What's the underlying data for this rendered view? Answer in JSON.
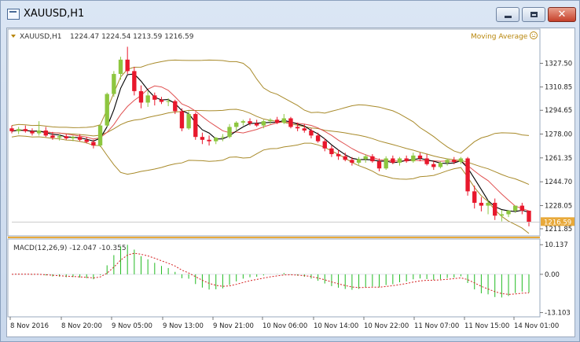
{
  "window": {
    "title": "XAUUSD,H1",
    "buttons": [
      "minimize",
      "maximize",
      "close"
    ],
    "close_glyph": "✕"
  },
  "chart_header": {
    "symbol": "XAUUSD,H1",
    "ohlc": "1224.47 1224.54 1213.59 1216.59",
    "indicator_label": "Moving Average",
    "indicator_icon": "smiley-icon"
  },
  "macd_header": {
    "label": "MACD(12,26,9) -12.047 -10.355"
  },
  "colors": {
    "bull": "#8dc63f",
    "bear": "#e8182c",
    "bands": "#a88a2a",
    "ma_fast": "#000000",
    "ma_slow": "#e05050",
    "macd_hist": "#22bb22",
    "macd_signal": "#d42020",
    "grid_text": "#222222",
    "price_tag": "#e8a93a"
  },
  "chart_data": [
    {
      "type": "candlestick",
      "title": "XAUUSD,H1",
      "y_ticks": [
        "1327.50",
        "1310.85",
        "1294.65",
        "1278.00",
        "1261.35",
        "1244.70",
        "1228.05",
        "1211.85"
      ],
      "ylim": [
        1208,
        1342
      ],
      "current_price": "1216.59",
      "x_ticks": [
        "8 Nov 2016",
        "8 Nov 20:00",
        "9 Nov 05:00",
        "9 Nov 13:00",
        "9 Nov 21:00",
        "10 Nov 06:00",
        "10 Nov 14:00",
        "10 Nov 22:00",
        "11 Nov 07:00",
        "11 Nov 15:00",
        "14 Nov 01:00"
      ],
      "candles": [
        [
          1282.0,
          1284.0,
          1278.5,
          1280.0
        ],
        [
          1280.0,
          1283.0,
          1278.0,
          1281.5
        ],
        [
          1281.5,
          1284.0,
          1279.0,
          1280.0
        ],
        [
          1280.0,
          1282.0,
          1277.0,
          1278.5
        ],
        [
          1278.5,
          1287.0,
          1277.0,
          1280.5
        ],
        [
          1280.5,
          1283.0,
          1276.0,
          1277.0
        ],
        [
          1277.0,
          1279.5,
          1274.0,
          1275.5
        ],
        [
          1275.5,
          1278.0,
          1273.5,
          1276.5
        ],
        [
          1276.5,
          1278.0,
          1274.0,
          1275.0
        ],
        [
          1275.0,
          1277.0,
          1273.0,
          1276.0
        ],
        [
          1276.0,
          1278.0,
          1273.0,
          1274.0
        ],
        [
          1274.0,
          1276.0,
          1271.5,
          1272.5
        ],
        [
          1272.5,
          1274.0,
          1268.0,
          1270.0
        ],
        [
          1270.0,
          1284.5,
          1269.0,
          1284.0
        ],
        [
          1284.0,
          1307.0,
          1283.0,
          1306.0
        ],
        [
          1306.0,
          1322.0,
          1304.0,
          1320.0
        ],
        [
          1320.0,
          1332.0,
          1316.0,
          1330.0
        ],
        [
          1330.0,
          1339.0,
          1320.0,
          1322.0
        ],
        [
          1322.0,
          1325.0,
          1305.0,
          1308.0
        ],
        [
          1308.0,
          1312.0,
          1296.0,
          1300.0
        ],
        [
          1300.0,
          1308.0,
          1297.0,
          1305.0
        ],
        [
          1305.0,
          1307.0,
          1298.0,
          1302.0
        ],
        [
          1302.0,
          1304.0,
          1299.0,
          1300.5
        ],
        [
          1300.5,
          1303.0,
          1297.5,
          1301.0
        ],
        [
          1301.0,
          1302.0,
          1292.0,
          1294.0
        ],
        [
          1294.0,
          1296.0,
          1280.0,
          1282.0
        ],
        [
          1282.0,
          1294.0,
          1281.0,
          1292.0
        ],
        [
          1292.0,
          1293.0,
          1274.0,
          1276.0
        ],
        [
          1276.0,
          1279.0,
          1271.0,
          1274.0
        ],
        [
          1274.0,
          1277.0,
          1270.0,
          1273.0
        ],
        [
          1273.0,
          1276.0,
          1271.0,
          1275.5
        ],
        [
          1275.5,
          1278.0,
          1273.0,
          1276.0
        ],
        [
          1276.0,
          1285.0,
          1275.0,
          1283.0
        ],
        [
          1283.0,
          1287.0,
          1280.0,
          1286.0
        ],
        [
          1286.0,
          1288.0,
          1284.0,
          1287.0
        ],
        [
          1287.0,
          1289.0,
          1284.0,
          1285.5
        ],
        [
          1285.5,
          1288.0,
          1283.0,
          1284.0
        ],
        [
          1284.0,
          1288.0,
          1282.0,
          1287.0
        ],
        [
          1287.0,
          1289.0,
          1285.0,
          1288.0
        ],
        [
          1288.0,
          1290.0,
          1285.0,
          1286.0
        ],
        [
          1286.0,
          1292.0,
          1285.0,
          1289.0
        ],
        [
          1289.0,
          1290.0,
          1282.0,
          1283.0
        ],
        [
          1283.0,
          1286.0,
          1280.0,
          1282.0
        ],
        [
          1282.0,
          1285.0,
          1279.0,
          1280.5
        ],
        [
          1280.5,
          1282.0,
          1275.0,
          1277.0
        ],
        [
          1277.0,
          1279.0,
          1272.0,
          1273.0
        ],
        [
          1273.0,
          1275.0,
          1266.0,
          1268.0
        ],
        [
          1268.0,
          1270.0,
          1262.0,
          1264.0
        ],
        [
          1264.0,
          1267.0,
          1260.0,
          1262.5
        ],
        [
          1262.5,
          1265.0,
          1259.0,
          1260.0
        ],
        [
          1260.0,
          1262.0,
          1256.0,
          1258.0
        ],
        [
          1258.0,
          1262.0,
          1256.5,
          1260.5
        ],
        [
          1260.5,
          1264.0,
          1258.0,
          1262.5
        ],
        [
          1262.5,
          1264.0,
          1258.0,
          1259.0
        ],
        [
          1259.0,
          1261.0,
          1252.0,
          1254.0
        ],
        [
          1254.0,
          1262.5,
          1253.0,
          1261.0
        ],
        [
          1261.0,
          1263.0,
          1257.0,
          1258.0
        ],
        [
          1258.0,
          1262.0,
          1256.0,
          1261.0
        ],
        [
          1261.0,
          1263.0,
          1258.0,
          1259.0
        ],
        [
          1259.0,
          1265.0,
          1258.0,
          1263.0
        ],
        [
          1263.0,
          1265.0,
          1259.0,
          1261.0
        ],
        [
          1261.0,
          1264.0,
          1256.0,
          1257.0
        ],
        [
          1257.0,
          1259.0,
          1253.0,
          1255.0
        ],
        [
          1255.0,
          1259.0,
          1254.0,
          1258.0
        ],
        [
          1258.0,
          1261.0,
          1256.0,
          1260.0
        ],
        [
          1260.0,
          1262.0,
          1257.0,
          1258.5
        ],
        [
          1258.5,
          1262.0,
          1257.0,
          1261.0
        ],
        [
          1261.0,
          1262.0,
          1235.0,
          1238.0
        ],
        [
          1238.0,
          1242.0,
          1226.0,
          1230.0
        ],
        [
          1230.0,
          1234.0,
          1224.0,
          1228.0
        ],
        [
          1228.0,
          1232.0,
          1222.0,
          1230.0
        ],
        [
          1230.0,
          1233.0,
          1218.0,
          1221.0
        ],
        [
          1221.0,
          1225.0,
          1217.0,
          1222.0
        ],
        [
          1222.0,
          1225.0,
          1220.0,
          1224.5
        ],
        [
          1224.5,
          1228.0,
          1223.0,
          1228.0
        ],
        [
          1228.0,
          1230.0,
          1222.0,
          1224.5
        ],
        [
          1224.5,
          1224.54,
          1213.59,
          1216.59
        ]
      ]
    },
    {
      "type": "macd",
      "title": "MACD(12,26,9) -12.047 -10.355",
      "y_ticks": [
        "10.137",
        "0.00",
        "-13.103"
      ],
      "ylim": [
        -14,
        11
      ]
    }
  ]
}
